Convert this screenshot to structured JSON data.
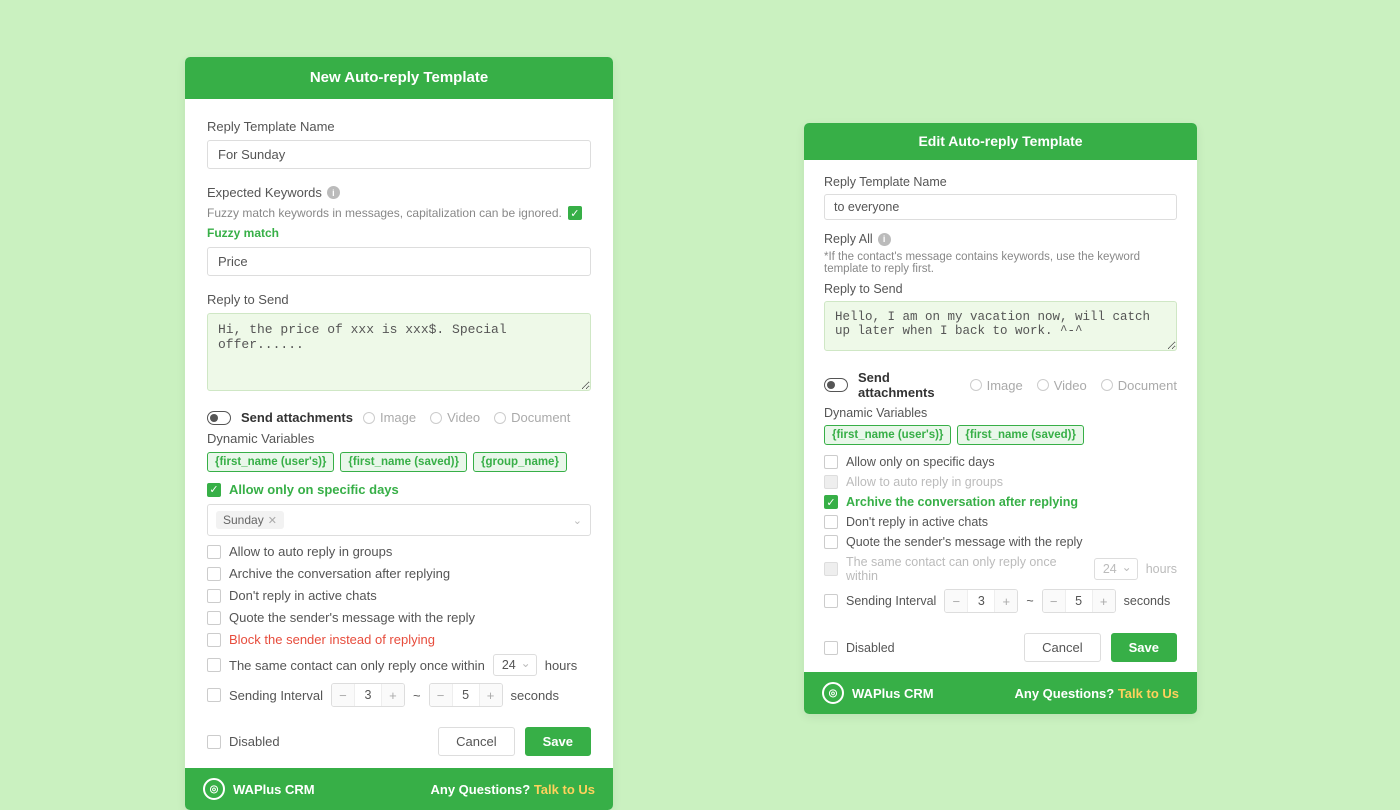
{
  "left": {
    "header": "New Auto-reply Template",
    "templateNameLabel": "Reply Template Name",
    "templateNameValue": "For Sunday",
    "keywordsLabel": "Expected Keywords",
    "keywordsHelp": "Fuzzy match keywords in messages, capitalization can be ignored.",
    "fuzzyLabel": "Fuzzy match",
    "keywordsValue": "Price",
    "replyLabel": "Reply to Send",
    "replyValue": "Hi, the price of xxx is xxx$. Special offer......",
    "sendAttachLabel": "Send attachments",
    "attachOptions": {
      "image": "Image",
      "video": "Video",
      "document": "Document"
    },
    "dynVarLabel": "Dynamic Variables",
    "dynVars": [
      "{first_name (user's)}",
      "{first_name (saved)}",
      "{group_name}"
    ],
    "allowDaysLabel": "Allow only on specific days",
    "daySelected": "Sunday",
    "opts": {
      "autoGroups": "Allow to auto reply in groups",
      "archive": "Archive the conversation after replying",
      "dontActive": "Don't reply in active chats",
      "quote": "Quote the sender's message with the reply",
      "block": "Block the sender instead of replying",
      "sameContactPre": "The same contact can only reply once within",
      "sameContactVal": "24",
      "sameContactUnit": "hours",
      "intervalLabel": "Sending Interval",
      "intervalFrom": "3",
      "intervalTo": "5",
      "intervalUnit": "seconds",
      "disabled": "Disabled"
    },
    "cancel": "Cancel",
    "save": "Save"
  },
  "right": {
    "header": "Edit Auto-reply Template",
    "templateNameLabel": "Reply Template Name",
    "templateNameValue": "to everyone",
    "replyAllLabel": "Reply All",
    "replyAllHelp": "*If the contact's message contains keywords, use the keyword template to reply first.",
    "replyLabel": "Reply to Send",
    "replyValue": "Hello, I am on my vacation now, will catch up later when I back to work. ^-^",
    "sendAttachLabel": "Send attachments",
    "attachOptions": {
      "image": "Image",
      "video": "Video",
      "document": "Document"
    },
    "dynVarLabel": "Dynamic Variables",
    "dynVars": [
      "{first_name (user's)}",
      "{first_name (saved)}"
    ],
    "opts": {
      "allowDays": "Allow only on specific days",
      "autoGroups": "Allow to auto reply in groups",
      "archive": "Archive the conversation after replying",
      "dontActive": "Don't reply in active chats",
      "quote": "Quote the sender's message with the reply",
      "sameContactPre": "The same contact can only reply once within",
      "sameContactVal": "24",
      "sameContactUnit": "hours",
      "intervalLabel": "Sending Interval",
      "intervalFrom": "3",
      "intervalTo": "5",
      "intervalUnit": "seconds",
      "disabled": "Disabled"
    },
    "cancel": "Cancel",
    "save": "Save"
  },
  "footer": {
    "brand": "WAPlus CRM",
    "questions": "Any Questions?",
    "talk": "Talk to Us"
  }
}
